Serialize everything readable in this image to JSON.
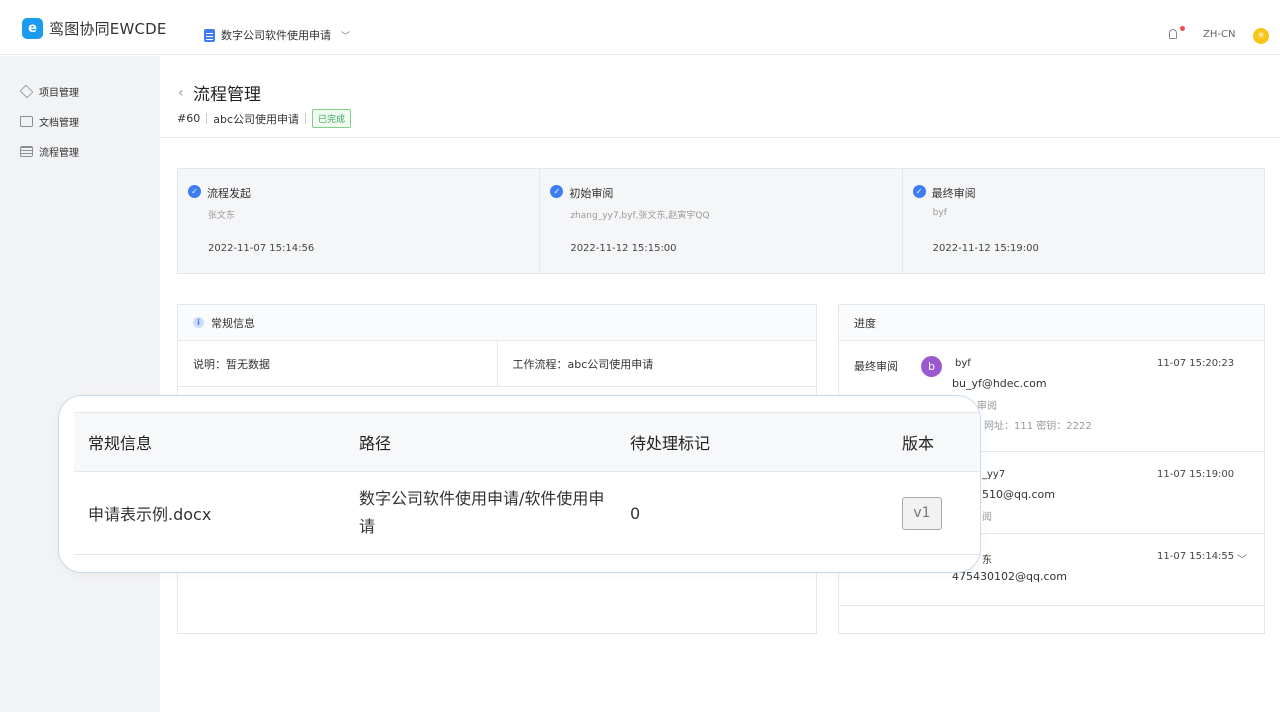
{
  "header": {
    "logo_glyph": "e",
    "app_name": "鸾图协同EWCDE",
    "project": "数字公司软件使用申请",
    "lang": "ZH-CN",
    "avatar_glyph": "✳"
  },
  "sidebar": {
    "items": [
      {
        "label": "项目管理",
        "icon": "layers-icon"
      },
      {
        "label": "文档管理",
        "icon": "folder-icon"
      },
      {
        "label": "流程管理",
        "icon": "flow-icon"
      }
    ]
  },
  "page": {
    "back": "‹",
    "title": "流程管理",
    "id": "#60",
    "name": "abc公司使用申请",
    "status": "已完成"
  },
  "steps": [
    {
      "title": "流程发起",
      "who": "张文东",
      "time": "2022-11-07 15:14:56"
    },
    {
      "title": "初始审阅",
      "who": "zhang_yy7,byf,张文东,赵寅宇QQ",
      "time": "2022-11-12 15:15:00"
    },
    {
      "title": "最终审阅",
      "who": "byf",
      "time": "2022-11-12 15:19:00"
    }
  ],
  "general": {
    "header": "常规信息",
    "description": "说明：暂无数据",
    "workflow": "工作流程：abc公司使用申请"
  },
  "progress": {
    "header": "进度",
    "entries": [
      {
        "stage": "最终审阅",
        "avatar": "b",
        "name": "byf",
        "email": "bu_yf@hdec.com",
        "note1": "审阅",
        "note2": "网址：111 密钥：2222",
        "time": "11-07 15:20:23"
      },
      {
        "name": "_yy7",
        "email": "510@qq.com",
        "note1": "阅",
        "time": "11-07 15:19:00"
      },
      {
        "name": "东",
        "email": "475430102@qq.com",
        "time": "11-07 15:14:55"
      }
    ]
  },
  "popup": {
    "headers": [
      "常规信息",
      "路径",
      "待处理标记",
      "版本"
    ],
    "row": {
      "file": "申请表示例.docx",
      "path": "数字公司软件使用申请/软件使用申请",
      "pending": "0",
      "version": "v1"
    }
  }
}
